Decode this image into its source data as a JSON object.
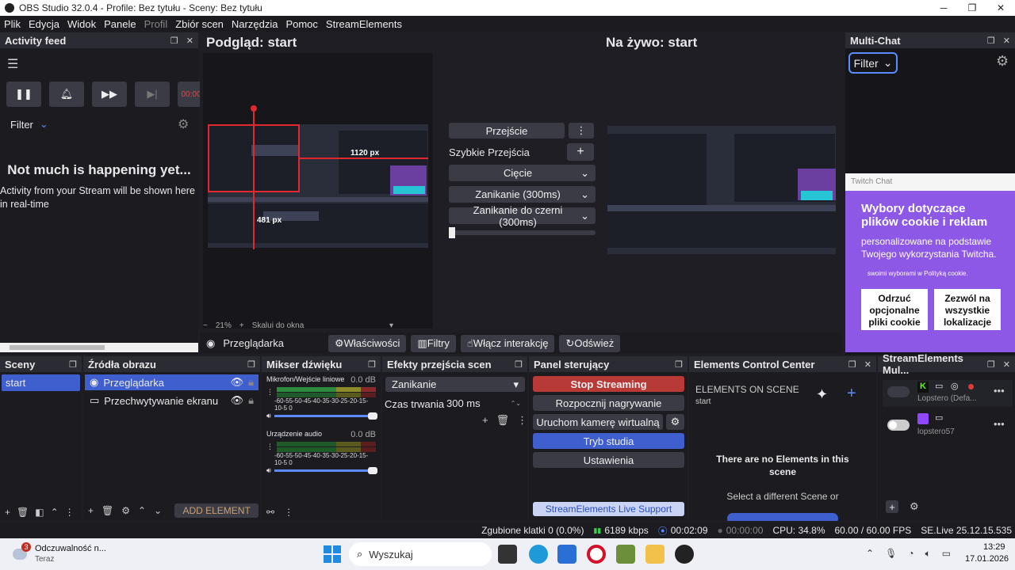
{
  "window": {
    "title": "OBS Studio 32.0.4 - Profile: Bez tytułu - Sceny: Bez tytułu"
  },
  "menu": [
    "Plik",
    "Edycja",
    "Widok",
    "Panele",
    "Profil",
    "Zbiór scen",
    "Narzędzia",
    "Pomoc",
    "StreamElements"
  ],
  "activity": {
    "title": "Activity feed",
    "filter": "Filter",
    "time_badge": "00:00",
    "empty_title": "Not much is happening yet...",
    "empty_text": "Activity from your Stream will be shown here in real-time"
  },
  "preview": {
    "title": "Podgląd: start",
    "zoom": "21%",
    "scale": "Skalui do okna",
    "w_label": "1120 px",
    "h_label": "481 px"
  },
  "live": {
    "title": "Na żywo: start"
  },
  "transitions": {
    "transition_btn": "Przejście",
    "quick": "Szybkie Przejścia",
    "items": [
      "Cięcie",
      "Zanikanie (300ms)",
      "Zanikanie do czerni (300ms)"
    ]
  },
  "source_bar": {
    "source": "Przeglądarka",
    "properties": "Właściwości",
    "filters": "Filtry",
    "interact": "Włącz interakcję",
    "refresh": "Odśwież"
  },
  "multichat": {
    "title": "Multi-Chat",
    "filter": "Filter",
    "twitch_label": "Twitch Chat",
    "cookie_title": "Wybory dotyczące plików cookie i reklam",
    "cookie_text": "personalizowane na podstawie Twojego wykorzystania Twitcha.",
    "cookie_link": "swoimi wyborami w Polityką cookie.",
    "btn_reject": "Odrzuć opcjonalne pliki cookie",
    "btn_accept": "Zezwól na wszystkie lokalizacje"
  },
  "scenes": {
    "title": "Sceny",
    "items": [
      "start"
    ]
  },
  "sources": {
    "title": "Źródła obrazu",
    "items": [
      "Przeglądarka",
      "Przechwytywanie ekranu"
    ],
    "add": "ADD ELEMENT"
  },
  "mixer": {
    "title": "Mikser dźwięku",
    "channels": [
      {
        "name": "Mikrofon/Wejście liniowe",
        "db": "0.0 dB"
      },
      {
        "name": "Urządzenie audio",
        "db": "0.0 dB"
      }
    ],
    "scale": "-60-55-50-45-40-35-30-25-20-15-10-5 0"
  },
  "effects": {
    "title": "Efekty przejścia scen",
    "selected": "Zanikanie",
    "duration_label": "Czas trwania",
    "duration": "300 ms"
  },
  "controls": {
    "title": "Panel sterujący",
    "stop": "Stop Streaming",
    "record": "Rozpocznij nagrywanie",
    "vcam": "Uruchom kamerę wirtualną",
    "studio": "Tryb studia",
    "settings": "Ustawienia",
    "support": "StreamElements Live Support"
  },
  "ecc": {
    "title": "Elements Control Center",
    "on_scene": "ELEMENTS ON SCENE",
    "scene": "start",
    "empty_title": "There are no Elements in this scene",
    "empty_text": "Select a different Scene or"
  },
  "semulti": {
    "title": "StreamElements Mul...",
    "accounts": [
      {
        "name": "Lopstero (Defa...",
        "platform": "kick"
      },
      {
        "name": "lopstero57",
        "platform": "twitch"
      }
    ]
  },
  "status": {
    "dropped": "Zgubione klatki 0 (0.0%)",
    "kbps": "6189 kbps",
    "stream_time": "00:02:09",
    "rec_time": "00:00:00",
    "cpu": "CPU: 34.8%",
    "fps": "60.00 / 60.00 FPS",
    "version": "SE.Live 25.12.15.535"
  },
  "taskbar": {
    "notif_title": "Odczuwalność n...",
    "notif_sub": "Teraz",
    "notif_count": "3",
    "search": "Wyszukaj",
    "time": "13:29",
    "date": "17.01.2026"
  },
  "colors": {
    "accent": "#3f5fce",
    "stop": "#b83a36",
    "purple": "#6b3fa0",
    "obs_bg": "#1e1e24"
  }
}
